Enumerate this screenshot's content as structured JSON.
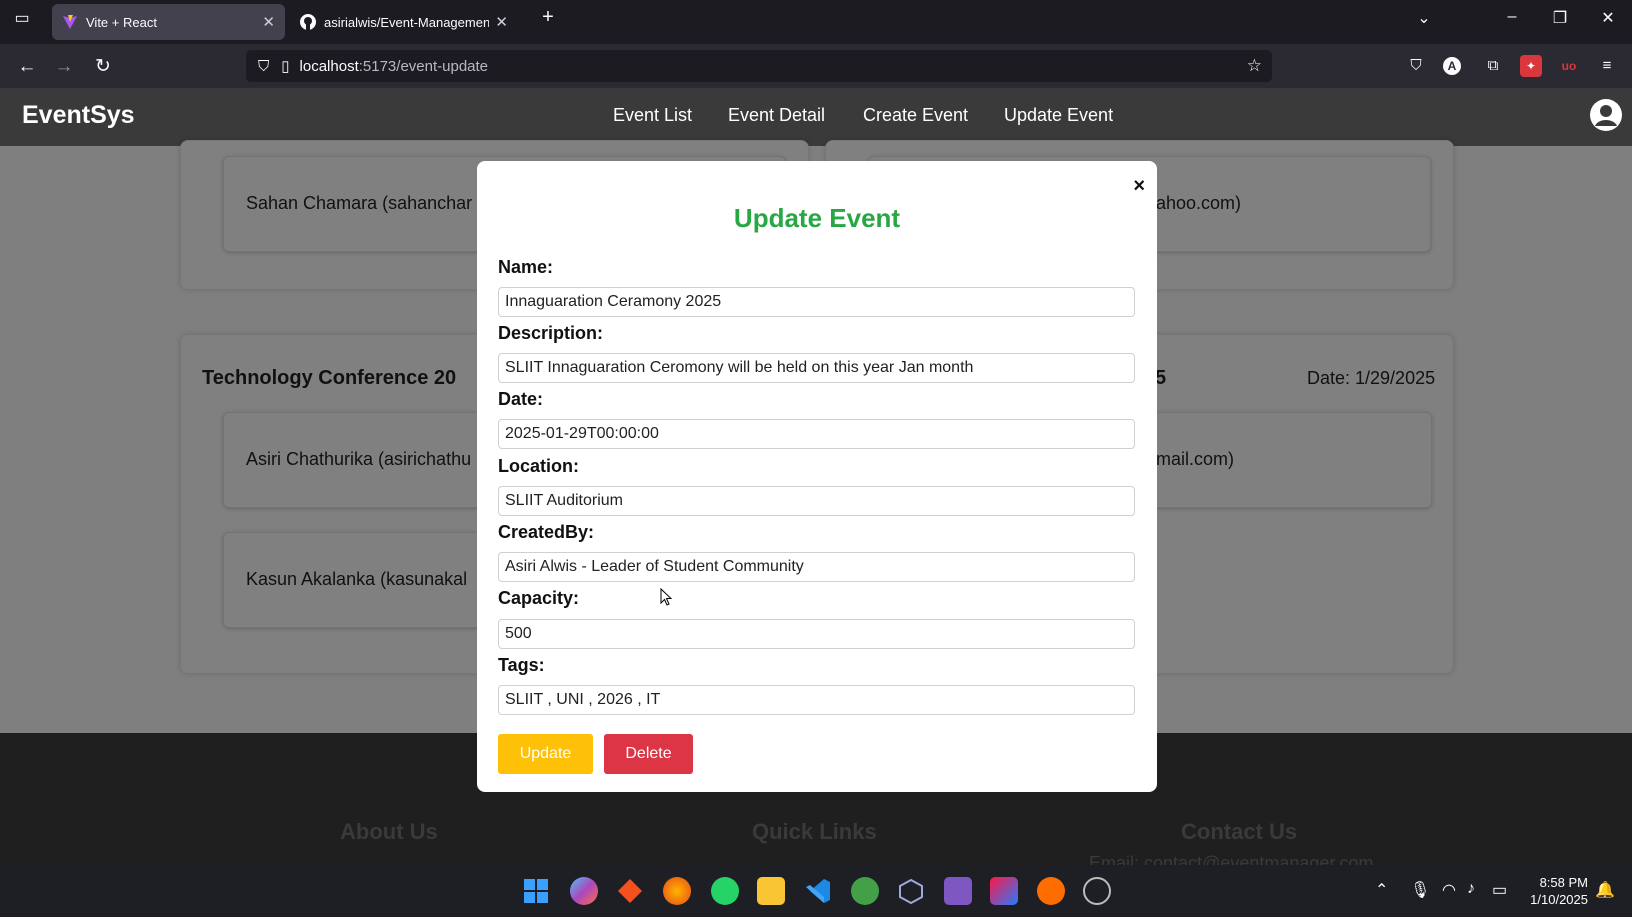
{
  "browser": {
    "tabs": [
      {
        "title": "Vite + React",
        "active": true
      },
      {
        "title": "asirialwis/Event-Management-S",
        "active": false
      }
    ],
    "url_host": "localhost",
    "url_path": ":5173/event-update"
  },
  "app": {
    "brand": "EventSys",
    "nav": [
      "Event List",
      "Event Detail",
      "Create Event",
      "Update Event"
    ]
  },
  "background": {
    "attendee_1": "Sahan Chamara (sahanchar",
    "attendee_1_right": "ahoo.com)",
    "event_title": "Technology Conference 20",
    "event_title_right": "5",
    "event_date": "Date: 1/29/2025",
    "attendee_2": "Asiri Chathurika (asirichathu",
    "attendee_2_right": "mail.com)",
    "attendee_3": "Kasun Akalanka (kasunakal"
  },
  "footer": {
    "about": "About Us",
    "links": "Quick Links",
    "contact": "Contact Us",
    "email_partial": "Email: contact@eventmanager.com"
  },
  "modal": {
    "title": "Update Event",
    "close": "×",
    "fields": {
      "name_label": "Name:",
      "name_value": "Innaguaration Ceramony 2025",
      "description_label": "Description:",
      "description_value": "SLIIT Innaguaration Ceromony will be held on this year Jan month",
      "date_label": "Date:",
      "date_value": "2025-01-29T00:00:00",
      "location_label": "Location:",
      "location_value": "SLIIT Auditorium",
      "createdby_label": "CreatedBy:",
      "createdby_value": "Asiri Alwis - Leader of Student Community",
      "capacity_label": "Capacity:",
      "capacity_value": "500",
      "tags_label": "Tags:",
      "tags_value": "SLIIT , UNI , 2026 , IT"
    },
    "update_label": "Update",
    "delete_label": "Delete"
  },
  "taskbar": {
    "time": "8:58 PM",
    "date": "1/10/2025"
  },
  "colors": {
    "accent_green": "#28a745",
    "update_yellow": "#ffc107",
    "delete_red": "#dc3545"
  }
}
